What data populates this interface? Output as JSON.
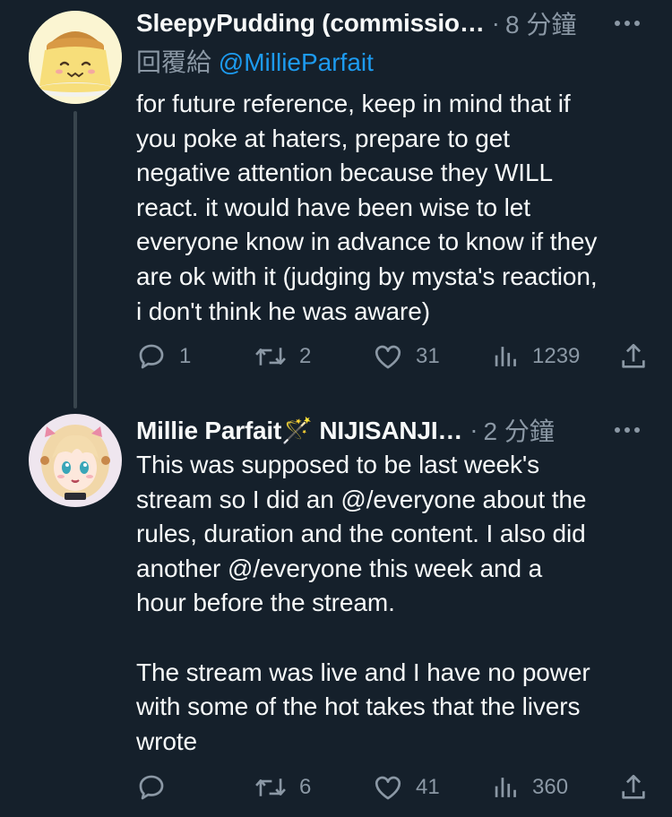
{
  "tweets": [
    {
      "author": "SleepyPudding (commissio…",
      "separator": "·",
      "time": "8 分鐘",
      "reply_prefix": "回覆給 ",
      "reply_handle": "@MillieParfait",
      "text": "for future reference, keep in mind that if\nyou poke at haters, prepare to get\nnegative attention because they WILL\nreact. it would have been wise to let\neveryone know in advance to know if they\nare ok with it (judging by mysta's reaction,\ni don't think he was aware)",
      "replies": "1",
      "retweets": "2",
      "likes": "31",
      "views": "1239"
    },
    {
      "author": "Millie Parfait🪄 NIJISANJI…",
      "separator": "·",
      "time": "2 分鐘",
      "text": "This was supposed to be last week's\nstream so I did an @/everyone about the\nrules, duration and the content. I also did\nanother @/everyone this week and a\nhour before the stream.\n\nThe stream was live and I have no power\nwith some of the hot takes that the livers\nwrote",
      "replies": "",
      "retweets": "6",
      "likes": "41",
      "views": "360"
    }
  ],
  "colors": {
    "background": "#15202b",
    "text": "#f7f9f9",
    "secondary": "#8b98a5",
    "link": "#1d9bf0",
    "thread_line": "#38444d"
  },
  "icons": {
    "reply": "speech-bubble-icon",
    "retweet": "retweet-arrows-icon",
    "like": "heart-icon",
    "views": "bar-chart-icon",
    "share": "share-upload-icon",
    "more": "more-dots-icon"
  }
}
